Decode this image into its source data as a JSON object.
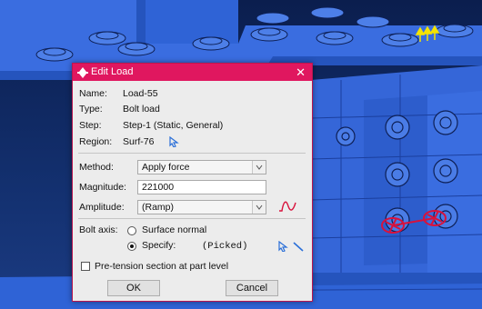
{
  "dialog": {
    "title": "Edit Load",
    "name_label": "Name:",
    "name_value": "Load-55",
    "type_label": "Type:",
    "type_value": "Bolt load",
    "step_label": "Step:",
    "step_value": "Step-1 (Static, General)",
    "region_label": "Region:",
    "region_value": "Surf-76",
    "method_label": "Method:",
    "method_value": "Apply force",
    "magnitude_label": "Magnitude:",
    "magnitude_value": "221000",
    "amplitude_label": "Amplitude:",
    "amplitude_value": "(Ramp)",
    "bolt_axis_label": "Bolt axis:",
    "surface_normal_label": "Surface normal",
    "specify_label": "Specify:",
    "picked_label": "(Picked)",
    "pretension_label": "Pre-tension section at part level",
    "ok_label": "OK",
    "cancel_label": "Cancel"
  },
  "state": {
    "surface_normal_selected": false,
    "specify_selected": true,
    "pretension_checked": false
  },
  "colors": {
    "title_bar": "#e0175f",
    "model_blue": "#2f63d6",
    "load_red": "#d8123c",
    "bc_yellow": "#f5e400",
    "background": "#0b1e4e"
  },
  "icons": [
    "edit-load-icon",
    "close-icon",
    "select-arrow-icon",
    "amplitude-wave-icon",
    "axis-line-icon",
    "load-symbol-icon",
    "bc-arrows-icon"
  ]
}
